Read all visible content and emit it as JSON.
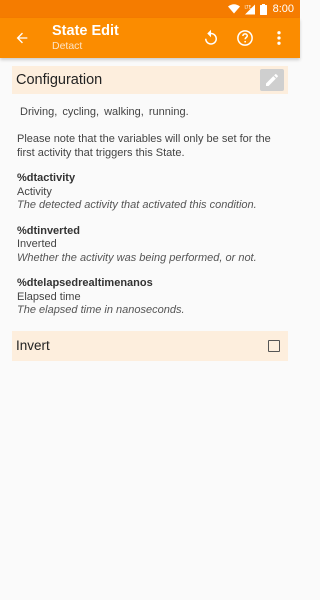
{
  "status_bar": {
    "time": "8:00",
    "icons": [
      "wifi-icon",
      "signal-lte-icon",
      "battery-icon"
    ],
    "network_type": "LTE"
  },
  "app_bar": {
    "title": "State Edit",
    "subtitle": "Detact",
    "background": "#fb8c00",
    "actions": [
      "back-arrow-icon",
      "reset-icon",
      "help-icon",
      "more-vert-icon"
    ]
  },
  "configuration": {
    "label": "Configuration",
    "edit_icon": "pencil-icon",
    "activities": "Driving,  cycling,  walking,  running.",
    "note": "Please note that the variables will only be set for the first activity that triggers this State.",
    "variables": [
      {
        "name": "%dtactivity",
        "title": "Activity",
        "description": "The detected activity that activated this condition."
      },
      {
        "name": "%dtinverted",
        "title": "Inverted",
        "description": "Whether the activity was being performed, or not."
      },
      {
        "name": "%dtelapsedrealtimenanos",
        "title": "Elapsed time",
        "description": "The elapsed time in nanoseconds."
      }
    ]
  },
  "invert": {
    "label": "Invert",
    "checked": false
  },
  "colors": {
    "accent": "#fb8c00",
    "status_bar": "#f57c00",
    "section_bg": "#fdeedd"
  }
}
